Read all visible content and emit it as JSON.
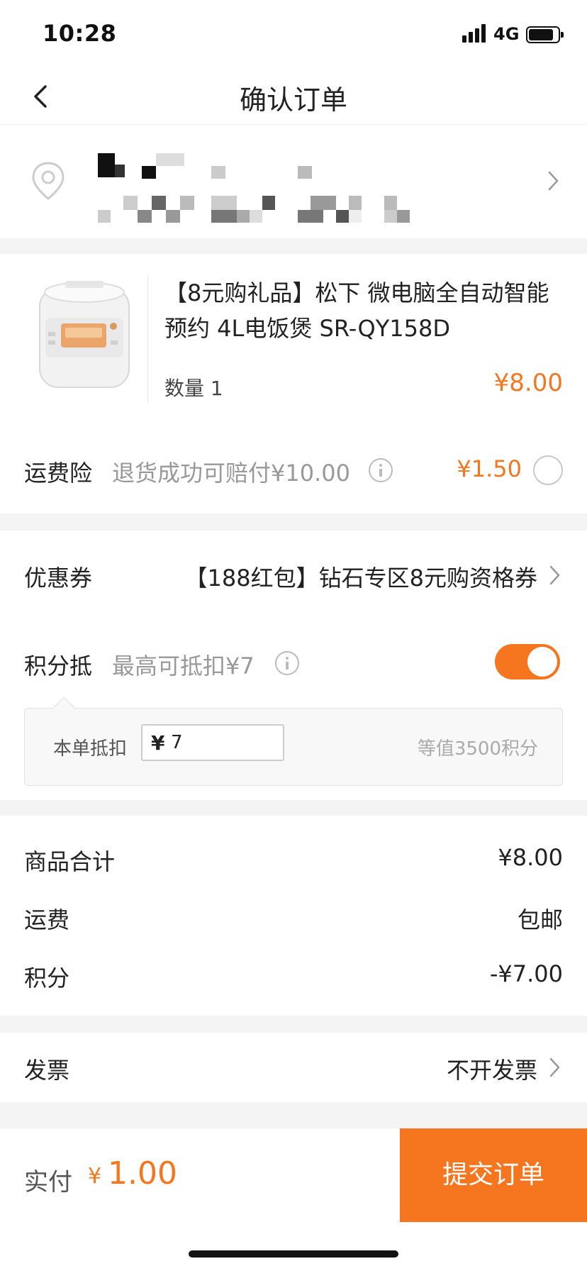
{
  "status_bar": {
    "time": "10:28",
    "network": "4G"
  },
  "nav": {
    "title": "确认订单"
  },
  "product": {
    "title": "【8元购礼品】松下 微电脑全自动智能预约 4L电饭煲 SR-QY158D",
    "quantity": "数量 1",
    "price": "¥8.00"
  },
  "insurance": {
    "label": "运费险",
    "description": "退货成功可赔付¥10.00",
    "price": "¥1.50"
  },
  "coupon": {
    "label": "优惠券",
    "value": "【188红包】钻石专区8元购资格券"
  },
  "points": {
    "label": "积分抵",
    "description": "最高可抵扣¥7",
    "enabled": true,
    "deduct_label": "本单抵扣",
    "currency_symbol": "¥",
    "deduct_value": "7",
    "equivalent": "等值3500积分"
  },
  "summary": {
    "items": [
      {
        "label": "商品合计",
        "value": "¥8.00"
      },
      {
        "label": "运费",
        "value": "包邮"
      },
      {
        "label": "积分",
        "value": "-¥7.00"
      }
    ]
  },
  "invoice": {
    "label": "发票",
    "value": "不开发票"
  },
  "bottom_bar": {
    "pay_label": "实付",
    "currency_symbol": "¥",
    "amount": "1.00",
    "submit_label": "提交订单"
  },
  "colors": {
    "accent": "#f5761f",
    "muted_text": "#999999",
    "divider": "#ececec",
    "section_gap": "#f4f4f4"
  },
  "icons": [
    "back-arrow-icon",
    "location-pin-icon",
    "chevron-right-icon",
    "info-icon",
    "signal-icon",
    "battery-icon"
  ]
}
